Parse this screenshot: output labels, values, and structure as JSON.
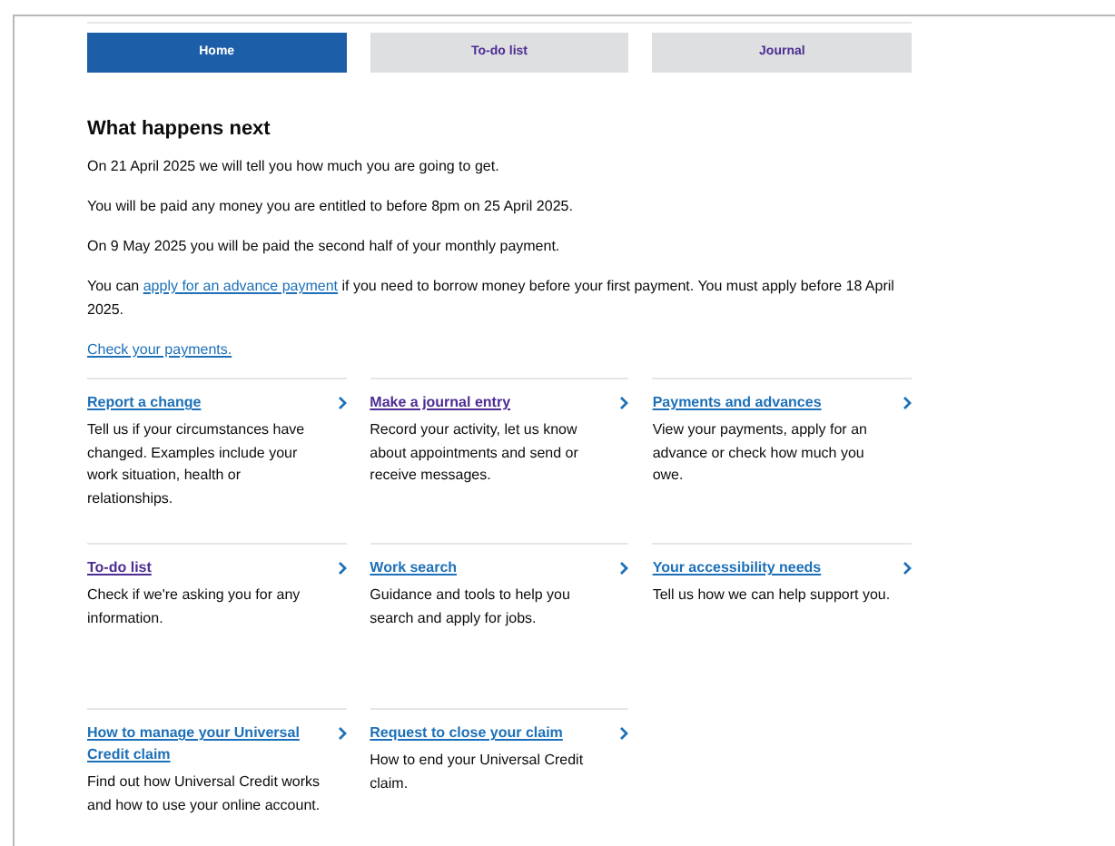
{
  "tabs": [
    {
      "label": "Home",
      "selected": true
    },
    {
      "label": "To-do list",
      "selected": false,
      "visited": true
    },
    {
      "label": "Journal",
      "selected": false,
      "visited": true
    }
  ],
  "heading": "What happens next",
  "paragraphs": [
    [
      {
        "kind": "text",
        "text": "On 21 April 2025 we will tell you how much you are going to get."
      }
    ],
    [
      {
        "kind": "text",
        "text": "You will be paid any money you are entitled to before 8pm on 25 April 2025."
      }
    ],
    [
      {
        "kind": "text",
        "text": "On 9 May 2025 you will be paid the second half of your monthly payment."
      }
    ],
    [
      {
        "kind": "text",
        "text": "You can "
      },
      {
        "kind": "link",
        "text": "apply for an advance payment"
      },
      {
        "kind": "text",
        "text": " if you need to borrow money before your first payment. You must apply before 18 April 2025."
      }
    ],
    [
      {
        "kind": "link",
        "text": "Check your payments."
      }
    ]
  ],
  "cards": [
    {
      "title": "Report a change",
      "visited": false,
      "description": "Tell us if your circumstances have changed. Examples include your work situation, health or relationships."
    },
    {
      "title": "Make a journal entry",
      "visited": true,
      "description": "Record your activity, let us know about appointments and send or receive messages."
    },
    {
      "title": "Payments and advances",
      "visited": false,
      "description": "View your payments, apply for an advance or check how much you owe."
    },
    {
      "title": "To-do list",
      "visited": true,
      "description": "Check if we're asking you for any information."
    },
    {
      "title": "Work search",
      "visited": false,
      "description": "Guidance and tools to help you search and apply for jobs."
    },
    {
      "title": "Your accessibility needs",
      "visited": false,
      "description": "Tell us how we can help support you."
    },
    {
      "title": "How to manage your Universal Credit claim",
      "visited": false,
      "description": "Find out how Universal Credit works and how to use your online account."
    },
    {
      "title": "Request to close your claim",
      "visited": false,
      "description": "How to end your Universal Credit claim."
    }
  ]
}
